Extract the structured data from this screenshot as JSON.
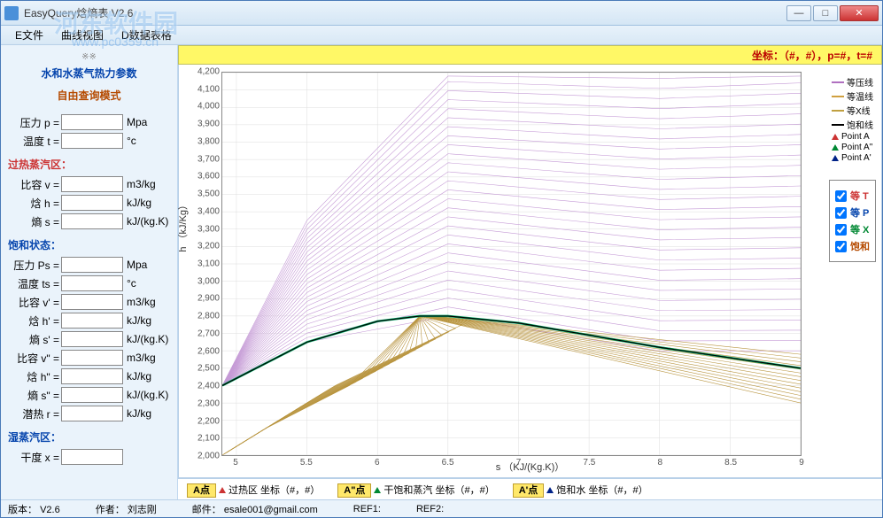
{
  "window": {
    "title": "EasyQuery焓熵表  V2.6"
  },
  "menu": {
    "file": "E文件",
    "curve": "曲线视图",
    "data": "D数据表格"
  },
  "watermark": {
    "main": "河东软件园",
    "sub": "www.pc0359.cn"
  },
  "sidebar": {
    "title": "水和水蒸气热力参数",
    "mode": "自由查询模式",
    "basic": {
      "p": {
        "label": "压力 p =",
        "value": "",
        "unit": "Mpa"
      },
      "t": {
        "label": "温度 t =",
        "value": "",
        "unit": "°c"
      }
    },
    "superheat_hdr": "过热蒸汽区：",
    "superheat": {
      "v": {
        "label": "比容 v =",
        "value": "",
        "unit": "m3/kg"
      },
      "h": {
        "label": "焓   h =",
        "value": "",
        "unit": "kJ/kg"
      },
      "s": {
        "label": "熵   s =",
        "value": "",
        "unit": "kJ/(kg.K)"
      }
    },
    "sat_hdr": "饱和状态：",
    "sat": {
      "ps": {
        "label": "压力 Ps =",
        "value": "",
        "unit": "Mpa"
      },
      "ts": {
        "label": "温度 ts =",
        "value": "",
        "unit": "°c"
      },
      "vp": {
        "label": "比容 v' =",
        "value": "",
        "unit": "m3/kg"
      },
      "hp": {
        "label": "焓   h' =",
        "value": "",
        "unit": "kJ/kg"
      },
      "sp": {
        "label": "熵   s' =",
        "value": "",
        "unit": "kJ/(kg.K)"
      },
      "vpp": {
        "label": "比容 v\" =",
        "value": "",
        "unit": "m3/kg"
      },
      "hpp": {
        "label": "焓   h\" =",
        "value": "",
        "unit": "kJ/kg"
      },
      "spp": {
        "label": "熵   s\" =",
        "value": "",
        "unit": "kJ/(kg.K)"
      },
      "r": {
        "label": "潜热 r =",
        "value": "",
        "unit": "kJ/kg"
      }
    },
    "wet_hdr": "湿蒸汽区：",
    "wet": {
      "x": {
        "label": "干度 x =",
        "value": "",
        "unit": ""
      }
    }
  },
  "chart": {
    "header": "坐标：（#，#），p=#，t=#",
    "ylabel": "h （kJ/Kg）",
    "xlabel": "s （KJ/(Kg.K)）",
    "legend": {
      "isobar": "等压线",
      "isotherm": "等温线",
      "isox": "等X线",
      "sat": "饱和线",
      "pa": "Point A",
      "papp": "Point A\"",
      "pap": "Point A'"
    },
    "checks": {
      "t": "等 T",
      "p": "等 P",
      "x": "等 X",
      "sat": "饱和"
    },
    "footer": {
      "a": "A点",
      "a_txt": "过热区 坐标（#，#）",
      "app": "A\"点",
      "app_txt": "干饱和蒸汽 坐标（#，#）",
      "ap": "A'点",
      "ap_txt": "饱和水 坐标（#，#）"
    }
  },
  "status": {
    "ver_l": "版本：",
    "ver": "V2.6",
    "auth_l": "作者：",
    "auth": "刘志刚",
    "mail_l": "邮件：",
    "mail": "esale001@gmail.com",
    "ref1": "REF1:",
    "ref2": "REF2:"
  },
  "chart_data": {
    "type": "line",
    "title": "",
    "xlabel": "s (kJ/(kg·K))",
    "ylabel": "h (kJ/kg)",
    "xlim": [
      4.9,
      9.0
    ],
    "ylim": [
      2000,
      4200
    ],
    "xticks": [
      5,
      5.5,
      6,
      6.5,
      7,
      7.5,
      8,
      8.5,
      9
    ],
    "yticks": [
      2000,
      2100,
      2200,
      2300,
      2400,
      2500,
      2600,
      2700,
      2800,
      2900,
      3000,
      3100,
      3200,
      3300,
      3400,
      3500,
      3600,
      3700,
      3800,
      3900,
      4000,
      4100,
      4200
    ],
    "series": [
      {
        "name": "饱和线",
        "color": "#000000",
        "x": [
          4.9,
          5.5,
          6.0,
          6.3,
          6.5,
          7.0,
          7.5,
          8.0,
          8.5,
          9.0
        ],
        "y": [
          2400,
          2650,
          2770,
          2800,
          2800,
          2760,
          2690,
          2620,
          2560,
          2500
        ]
      },
      {
        "name": "等压线(示例)",
        "color": "#b070c0",
        "x": [
          4.9,
          6.0,
          7.0,
          8.0,
          9.0
        ],
        "y": [
          2400,
          3500,
          4000,
          4120,
          4150
        ]
      },
      {
        "name": "等温线(示例)",
        "color": "#d0a040",
        "x": [
          4.9,
          9.0
        ],
        "y": [
          2800,
          2800
        ]
      },
      {
        "name": "等X线(示例)",
        "color": "#c0a040",
        "x": [
          4.9,
          6.3
        ],
        "y": [
          2000,
          2800
        ]
      }
    ],
    "legend_position": "right"
  }
}
